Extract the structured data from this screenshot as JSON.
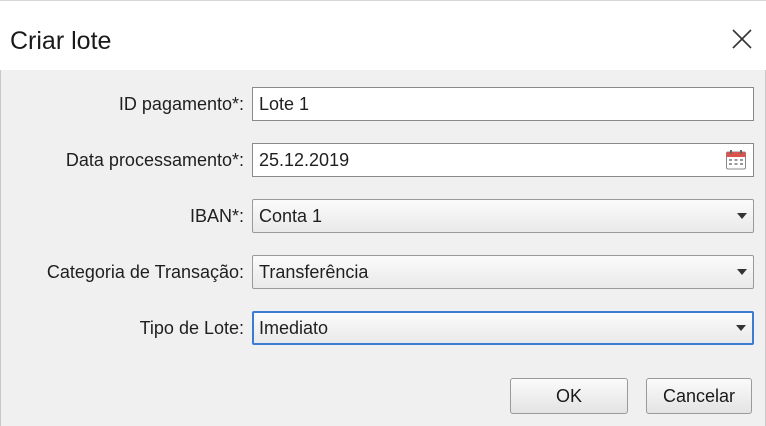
{
  "dialog": {
    "title": "Criar lote",
    "close_icon": "close-icon"
  },
  "form": {
    "payment_id": {
      "label": "ID pagamento*:",
      "value": "Lote 1"
    },
    "processing_date": {
      "label": "Data processamento*:",
      "value": "25.12.2019",
      "icon": "calendar-icon"
    },
    "iban": {
      "label": "IBAN*:",
      "value": "Conta 1"
    },
    "transaction_category": {
      "label": "Categoria de Transação:",
      "value": "Transferência"
    },
    "batch_type": {
      "label": "Tipo de Lote:",
      "value": "Imediato"
    }
  },
  "buttons": {
    "ok_label": "OK",
    "cancel_label": "Cancelar"
  },
  "colors": {
    "focus_border": "#3a7bd5",
    "body_background": "#f0f0f0"
  }
}
